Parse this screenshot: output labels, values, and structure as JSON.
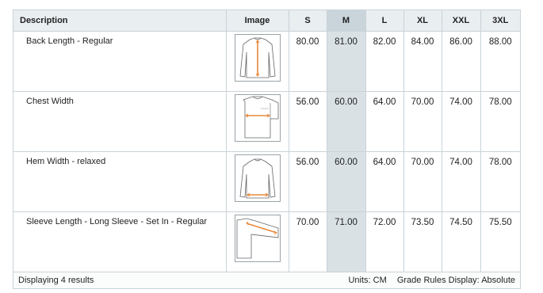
{
  "table": {
    "headers": {
      "description": "Description",
      "image": "Image",
      "sizes": [
        "S",
        "M",
        "L",
        "XL",
        "XXL",
        "3XL"
      ]
    },
    "highlighted_size": "M",
    "rows": [
      {
        "label": "Back Length - Regular",
        "image_icon": "garment-back-length-icon",
        "values": [
          "80.00",
          "81.00",
          "82.00",
          "84.00",
          "86.00",
          "88.00"
        ]
      },
      {
        "label": "Chest Width",
        "image_icon": "garment-chest-width-icon",
        "values": [
          "56.00",
          "60.00",
          "64.00",
          "70.00",
          "74.00",
          "78.00"
        ]
      },
      {
        "label": "Hem Width - relaxed",
        "image_icon": "garment-hem-width-icon",
        "values": [
          "56.00",
          "60.00",
          "64.00",
          "70.00",
          "74.00",
          "78.00"
        ]
      },
      {
        "label": "Sleeve Length - Long Sleeve - Set In - Regular",
        "image_icon": "garment-sleeve-length-icon",
        "values": [
          "70.00",
          "71.00",
          "72.00",
          "73.50",
          "74.50",
          "75.50"
        ]
      }
    ]
  },
  "footer": {
    "results": "Displaying 4 results",
    "units": "Units: CM",
    "grade_rules": "Grade Rules Display: Absolute"
  },
  "colors": {
    "measure_line": "#e8893b",
    "border": "#c9d3d9",
    "highlight": "#d9e1e5"
  }
}
